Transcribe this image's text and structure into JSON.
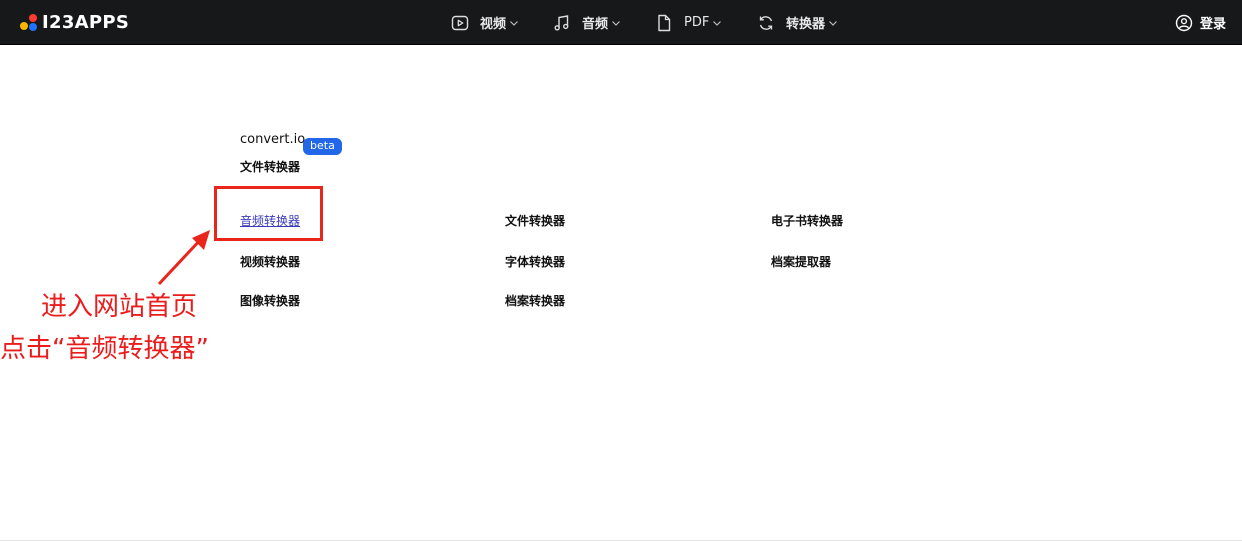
{
  "header": {
    "logo_text": "I23APPS",
    "nav": [
      {
        "label": "视频",
        "icon": "video-play-icon"
      },
      {
        "label": "音频",
        "icon": "music-note-icon"
      },
      {
        "label": "PDF",
        "icon": "document-icon"
      },
      {
        "label": "转换器",
        "icon": "refresh-icon"
      }
    ],
    "login_label": "登录"
  },
  "brand": {
    "name": "convert.io",
    "badge": "beta",
    "subtitle": "文件转换器"
  },
  "converters": {
    "col1": [
      "音频转换器",
      "视频转换器",
      "图像转换器"
    ],
    "col2": [
      "文件转换器",
      "字体转换器",
      "档案转换器"
    ],
    "col3": [
      "电子书转换器",
      "档案提取器"
    ]
  },
  "annotation": {
    "line1": "进入网站首页",
    "line2": "点击“音频转换器”"
  },
  "colors": {
    "topbar_bg": "#17181a",
    "beta_bg": "#2167e8",
    "annotation_red": "#ea1c1c",
    "active_link": "#3a3ab8"
  }
}
